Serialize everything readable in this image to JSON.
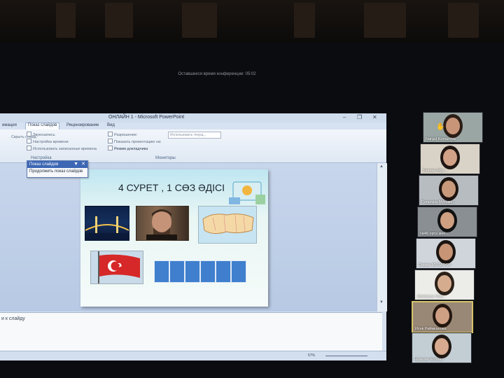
{
  "meeting": {
    "timer": "Оставшееся время конференции: 05:02"
  },
  "powerpoint": {
    "title": "ОНЛАЙН 1 - Microsoft PowerPoint",
    "window_controls": [
      "–",
      "❐",
      "✕"
    ],
    "tabs": [
      "имация",
      "Показ слайдов",
      "Рецензирование",
      "Вид"
    ],
    "active_tab": "Показ слайдов",
    "ribbon": {
      "items_col1": [
        "Звукозапись",
        "Настройка времени",
        "Использовать записанные времена"
      ],
      "hide_slide": "Скрыть слайд",
      "items_col2": [
        "Разрешение:",
        "Показать презентацию на:",
        "Режим докладчика"
      ],
      "resolution_value": "Использовать текущ...",
      "monitors_label": "Мониторы",
      "group_label": "Настройка"
    },
    "dropdown": {
      "title": "Показ слайдов",
      "item": "Продолжить показ слайдов"
    },
    "slide": {
      "title": "4 СУРЕТ , 1 СӨЗ ӘДІСІ",
      "answer_boxes": 6
    },
    "notes_placeholder": "и к слайду",
    "status": {
      "zoom": "57%"
    }
  },
  "participants": [
    {
      "name": "Nargul Kumarova",
      "bg": "#9aa6a4",
      "face": "#c99578",
      "hair": "#2a1d16"
    },
    {
      "name": "Бекжан Мук...",
      "bg": "#d9d2c6",
      "face": "#d1a287",
      "hair": "#1f1613"
    },
    {
      "name": "Гульнура Мукаме...",
      "bg": "#b7bcc1",
      "face": "#c89a7b",
      "hair": "#1c1410"
    },
    {
      "name": "№46 орта мек...",
      "bg": "#8a8f94",
      "face": "#cf9f82",
      "hair": "#111111"
    },
    {
      "name": "Dastan MUSAPOV",
      "bg": "#cfd5db",
      "face": "#c79476",
      "hair": "#1a1410"
    },
    {
      "name": "Алмагуль Сой...",
      "bg": "#ecece8",
      "face": "#d6ac8f",
      "hair": "#2c2118"
    },
    {
      "name": "Исек Раймканова",
      "bg": "#9a8876",
      "face": "#d0a085",
      "hair": "#24170f"
    },
    {
      "name": "Назерке Ерлан...",
      "bg": "#c3ced4",
      "face": "#d8ab90",
      "hair": "#1f1712"
    }
  ],
  "active_participant": 6
}
